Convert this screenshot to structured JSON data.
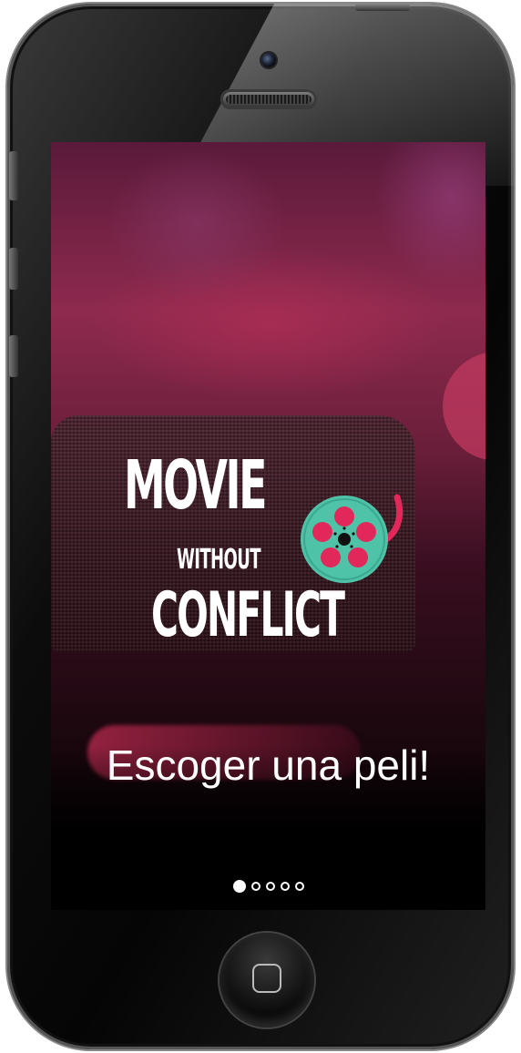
{
  "app": {
    "logo": {
      "line1": "MOVIE",
      "line2": "WITHOUT",
      "line3": "CONFLICT",
      "icon": "film-reel-icon"
    },
    "tagline": "Escoger una peli!",
    "carousel": {
      "total_pages": 5,
      "current_page": 1
    }
  },
  "device": {
    "home_button_icon": "home-button-icon"
  },
  "colors": {
    "reel_teal": "#4fc3a8",
    "reel_pink": "#e2285a",
    "text": "#ffffff",
    "background_magenta": "#8e2a4e"
  }
}
